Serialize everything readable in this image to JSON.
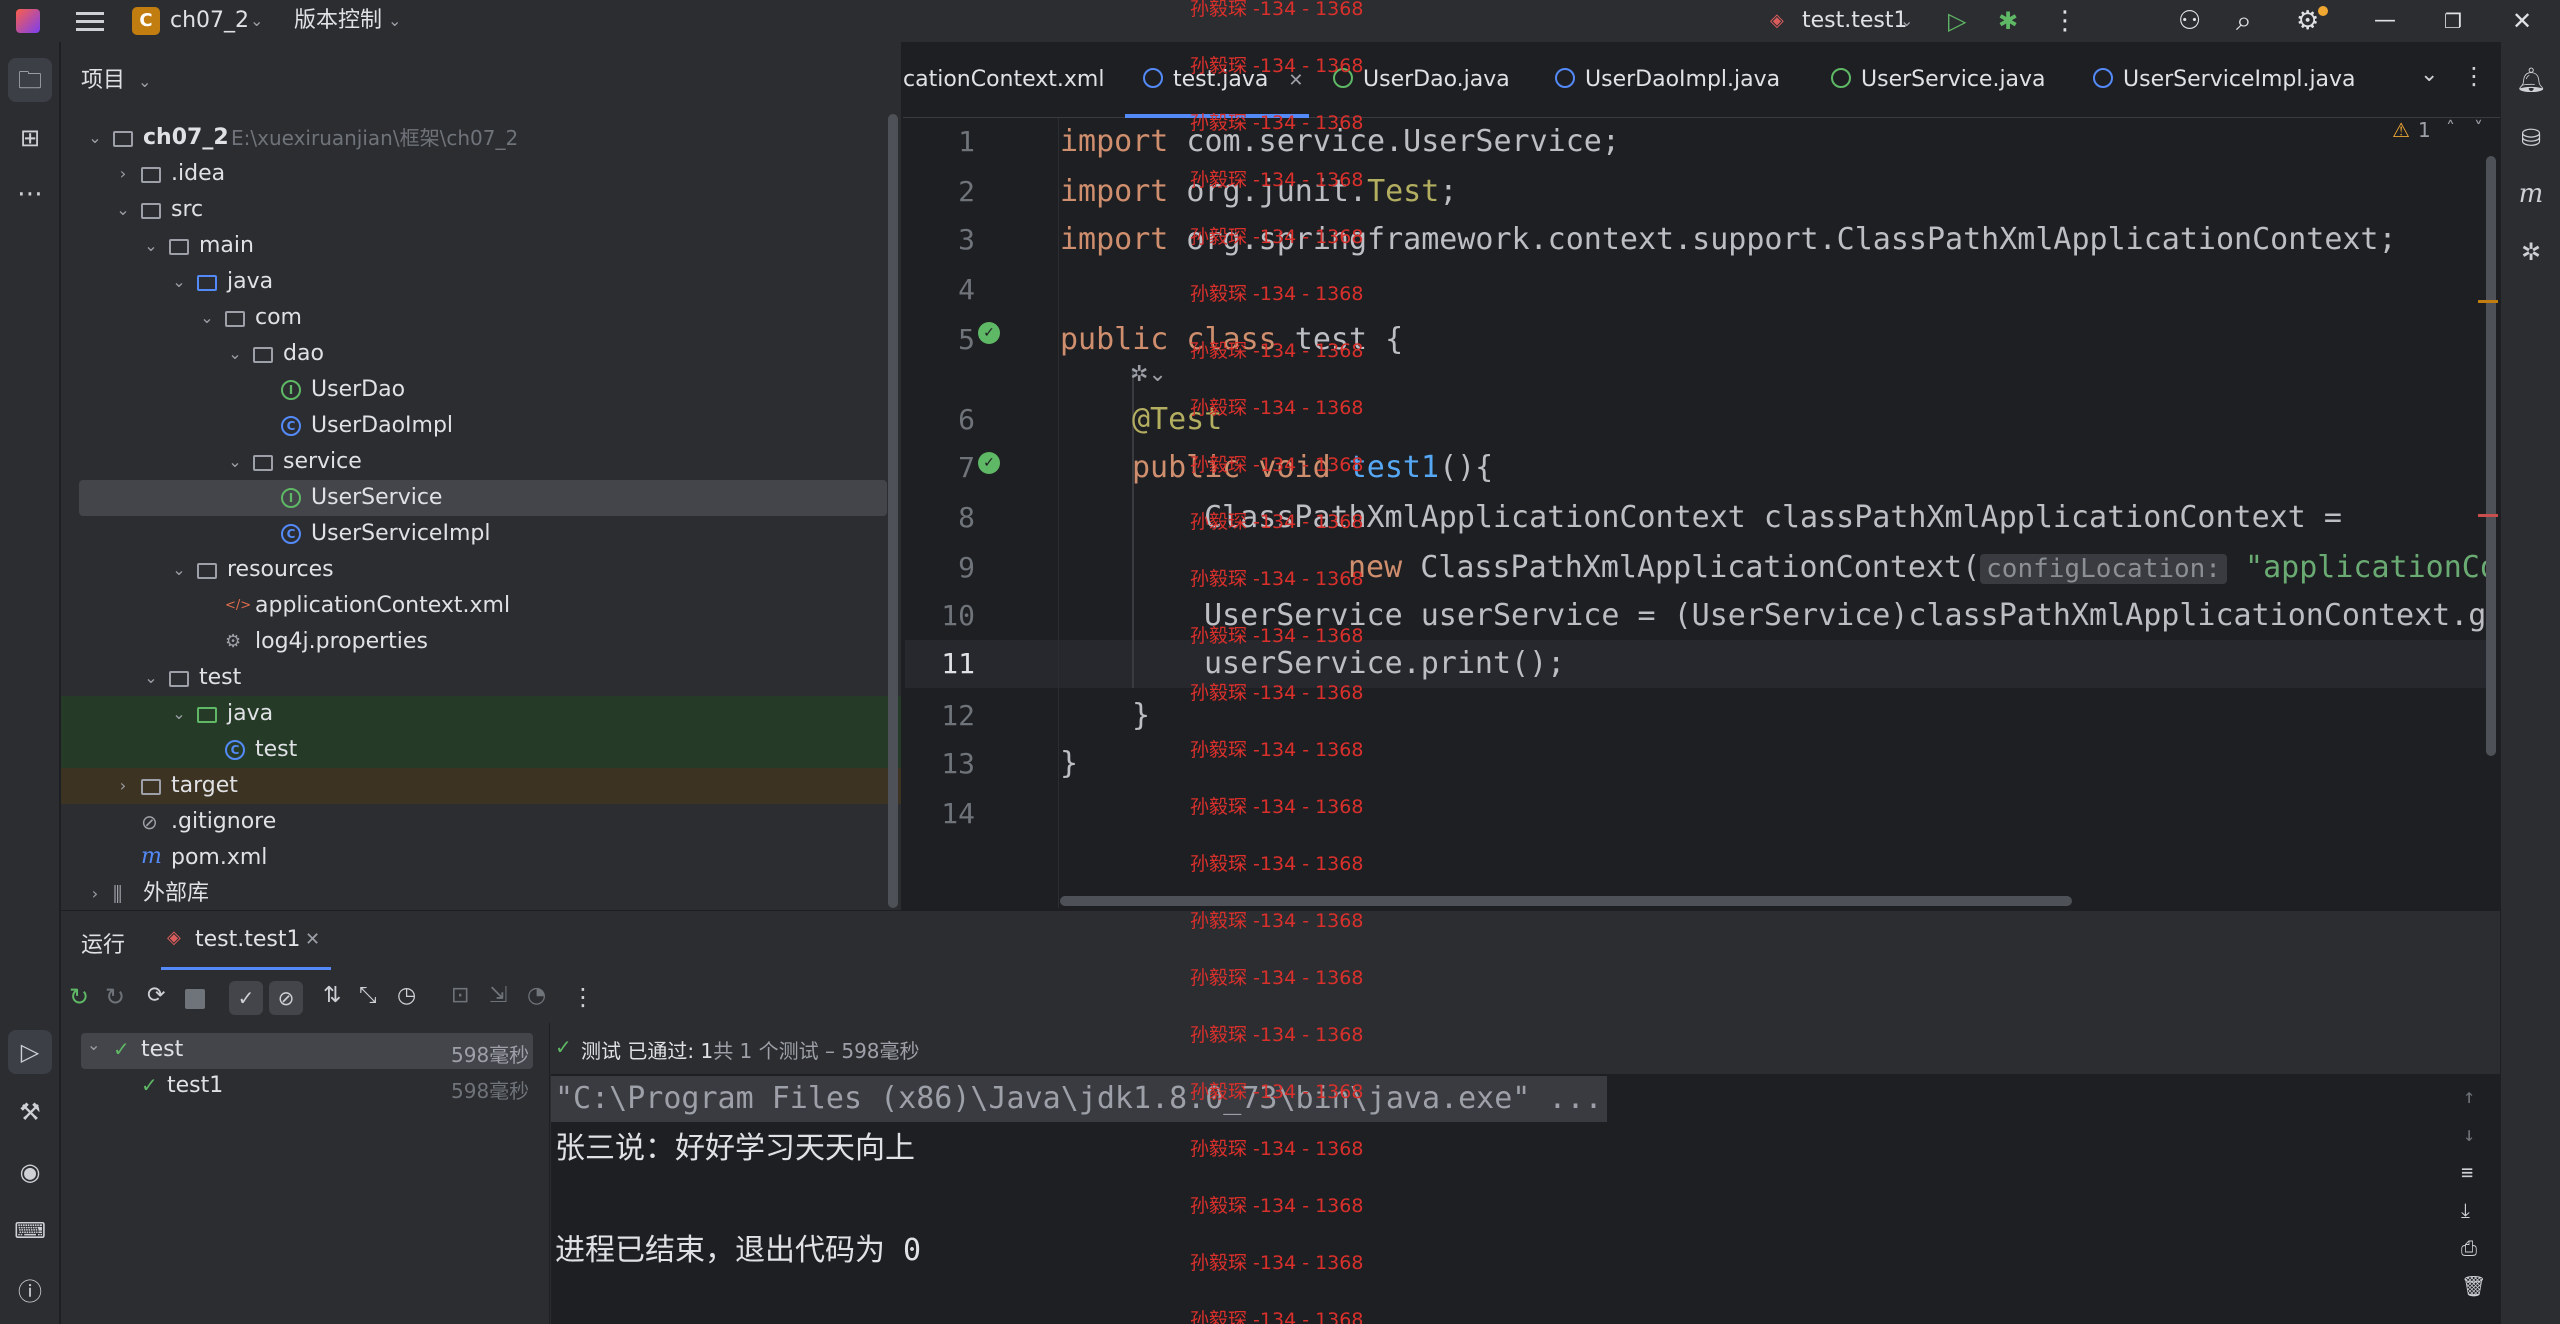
{
  "titlebar": {
    "project_badge": "C",
    "project_name": "ch07_2",
    "vcs_label": "版本控制",
    "run_config": "test.test1"
  },
  "project_panel": {
    "title": "项目",
    "tree": [
      {
        "label": "ch07_2",
        "path": "E:\\xuexiruanjian\\框架\\ch07_2",
        "indent": 0,
        "chevron": "⌄",
        "icon": "folder"
      },
      {
        "label": ".idea",
        "indent": 1,
        "chevron": "›",
        "icon": "folder"
      },
      {
        "label": "src",
        "indent": 1,
        "chevron": "⌄",
        "icon": "folder"
      },
      {
        "label": "main",
        "indent": 2,
        "chevron": "⌄",
        "icon": "folder"
      },
      {
        "label": "java",
        "indent": 3,
        "chevron": "⌄",
        "icon": "folder-blue"
      },
      {
        "label": "com",
        "indent": 4,
        "chevron": "⌄",
        "icon": "package"
      },
      {
        "label": "dao",
        "indent": 5,
        "chevron": "⌄",
        "icon": "package"
      },
      {
        "label": "UserDao",
        "indent": 6,
        "chevron": "",
        "icon": "interface"
      },
      {
        "label": "UserDaoImpl",
        "indent": 6,
        "chevron": "",
        "icon": "class"
      },
      {
        "label": "service",
        "indent": 5,
        "chevron": "⌄",
        "icon": "package"
      },
      {
        "label": "UserService",
        "indent": 6,
        "chevron": "",
        "icon": "interface",
        "selected": true
      },
      {
        "label": "UserServiceImpl",
        "indent": 6,
        "chevron": "",
        "icon": "class"
      },
      {
        "label": "resources",
        "indent": 3,
        "chevron": "⌄",
        "icon": "folder"
      },
      {
        "label": "applicationContext.xml",
        "indent": 4,
        "chevron": "",
        "icon": "xml"
      },
      {
        "label": "log4j.properties",
        "indent": 4,
        "chevron": "",
        "icon": "gear"
      },
      {
        "label": "test",
        "indent": 2,
        "chevron": "⌄",
        "icon": "folder"
      },
      {
        "label": "java",
        "indent": 3,
        "chevron": "⌄",
        "icon": "folder-green",
        "highlight": "test"
      },
      {
        "label": "test",
        "indent": 4,
        "chevron": "",
        "icon": "class",
        "highlight": "test"
      },
      {
        "label": "target",
        "indent": 1,
        "chevron": "›",
        "icon": "folder",
        "highlight": "target"
      },
      {
        "label": ".gitignore",
        "indent": 1,
        "chevron": "",
        "icon": "ignore"
      },
      {
        "label": "pom.xml",
        "indent": 1,
        "chevron": "",
        "icon": "maven"
      },
      {
        "label": "外部库",
        "indent": 0,
        "chevron": "›",
        "icon": "library"
      }
    ]
  },
  "editor": {
    "tabs": [
      {
        "label": "cationContext.xml",
        "icon": "xml"
      },
      {
        "label": "test.java",
        "icon": "class",
        "active": true
      },
      {
        "label": "UserDao.java",
        "icon": "interface"
      },
      {
        "label": "UserDaoImpl.java",
        "icon": "class"
      },
      {
        "label": "UserService.java",
        "icon": "interface"
      },
      {
        "label": "UserServiceImpl.java",
        "icon": "class"
      }
    ],
    "warning_count": "1",
    "line_numbers": [
      "1",
      "2",
      "3",
      "4",
      "5",
      "6",
      "7",
      "8",
      "9",
      "10",
      "11",
      "12",
      "13",
      "14"
    ],
    "code": {
      "l1_kw": "import",
      "l1_rest": " com.service.UserService;",
      "l2_kw": "import",
      "l2_a": " org.junit.",
      "l2_b": "Test",
      "l2_c": ";",
      "l3_kw": "import",
      "l3_rest": " org.springframework.context.support.ClassPathXmlApplicationContext;",
      "l5_kw": "public class",
      "l5_rest": " test {",
      "l6": "@Test",
      "l7_kw": "public void",
      "l7_fn": " test1",
      "l7_rest": "(){",
      "l8": "ClassPathXmlApplicationContext classPathXmlApplicationContext =",
      "l9_kw": "new",
      "l9_rest": " ClassPathXmlApplicationContext(",
      "l9_hint": "configLocation:",
      "l9_str": " \"applicationCont",
      "l10": "UserService userService = (UserService)classPathXmlApplicationContext.ge",
      "l11": "userService.print();",
      "l12": "}",
      "l13": "}"
    }
  },
  "run_panel": {
    "tab_run": "运行",
    "tab_config": "test.test1",
    "tree": [
      {
        "label": "test",
        "time": "598毫秒"
      },
      {
        "label": "test1",
        "time": "598毫秒"
      }
    ],
    "status_passed": "测试 已通过: 1",
    "status_rest": "共 1 个测试 – 598毫秒",
    "console": [
      "\"C:\\Program Files (x86)\\Java\\jdk1.8.0_73\\bin\\java.exe\" ...",
      "张三说：好好学习天天向上",
      "",
      "进程已结束，退出代码为 0"
    ]
  },
  "watermark": "孙毅琛 -134 - 1368",
  "colors": {
    "bg": "#1e1f22",
    "panel": "#2b2d30",
    "accent": "#548af7",
    "keyword": "#cf8e6d",
    "annotation": "#b3ae60",
    "success": "#5fb865",
    "watermark": "#d9302c"
  }
}
